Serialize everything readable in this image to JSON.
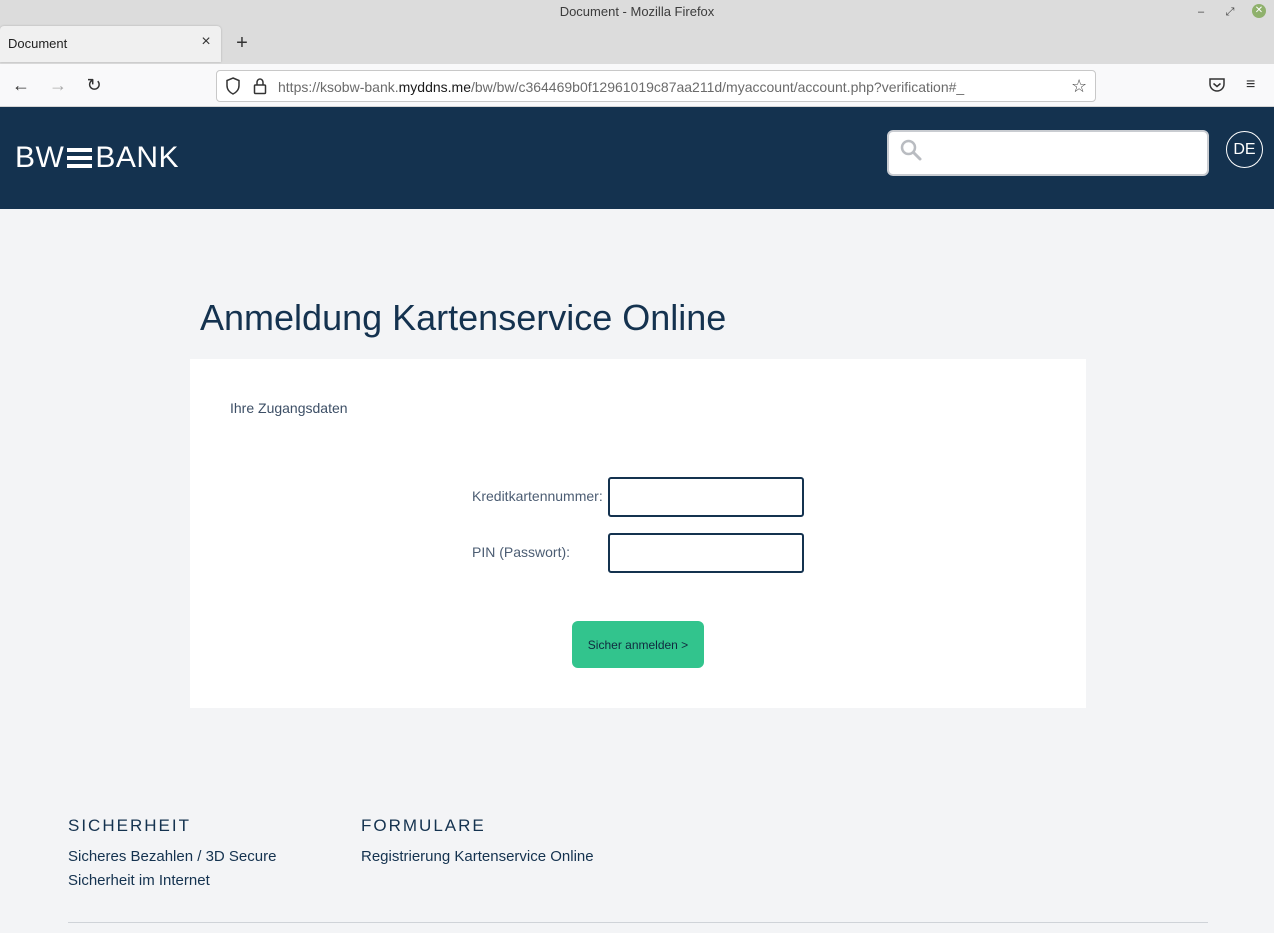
{
  "browser": {
    "window_title": "Document - Mozilla Firefox",
    "tab_title": "Document",
    "url_prefix": "https://ksobw-bank.",
    "url_domain": "myddns.me",
    "url_suffix": "/bw/bw/c364469b0f12961019c87aa211d/myaccount/account.php?verification#_"
  },
  "header": {
    "logo_left": "BW",
    "logo_right": "BANK",
    "search_placeholder": "",
    "language": "DE"
  },
  "main": {
    "title": "Anmeldung Kartenservice Online",
    "section_label": "Ihre Zugangsdaten",
    "card_number_label": "Kreditkartennummer:",
    "card_number_value": "",
    "pin_label": "PIN (Passwort):",
    "pin_value": "",
    "submit_label": "Sicher anmelden >"
  },
  "footer": {
    "columns": [
      {
        "heading": "SICHERHEIT",
        "links": [
          "Sicheres Bezahlen / 3D Secure",
          "Sicherheit im Internet"
        ]
      },
      {
        "heading": "FORMULARE",
        "links": [
          "Registrierung Kartenservice Online"
        ]
      }
    ]
  },
  "colors": {
    "brand_navy": "#14324f",
    "button_green": "#32c48d",
    "page_bg": "#f3f4f6"
  }
}
